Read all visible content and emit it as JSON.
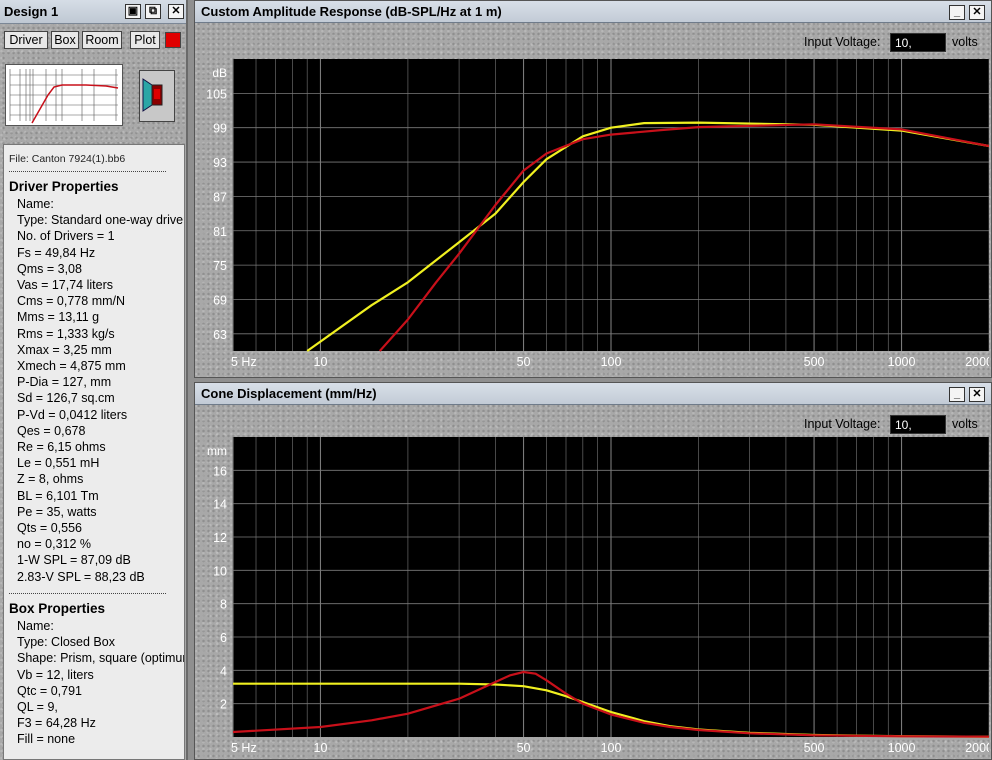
{
  "left_panel": {
    "title": "Design 1",
    "tabs": [
      "Driver",
      "Box",
      "Room",
      "Plot"
    ],
    "file": "File: Canton 7924(1).bb6",
    "driver_heading": "Driver Properties",
    "driver_lines": [
      "Name:",
      "Type: Standard one-way driver",
      "No. of Drivers = 1",
      "Fs = 49,84 Hz",
      "Qms = 3,08",
      "Vas = 17,74 liters",
      "Cms = 0,778 mm/N",
      "Mms = 13,11 g",
      "Rms = 1,333 kg/s",
      "Xmax = 3,25 mm",
      "Xmech = 4,875 mm",
      "P-Dia = 127, mm",
      "Sd = 126,7 sq.cm",
      "P-Vd = 0,0412 liters",
      "Qes = 0,678",
      "Re = 6,15 ohms",
      "Le = 0,551 mH",
      "Z = 8, ohms",
      "BL = 6,101 Tm",
      "Pe = 35, watts",
      "Qts = 0,556",
      "no = 0,312 %",
      "1-W SPL = 87,09 dB",
      "2.83-V SPL = 88,23 dB"
    ],
    "box_heading": "Box Properties",
    "box_lines": [
      "Name:",
      "Type: Closed Box",
      "Shape: Prism, square (optimum)",
      "Vb = 12, liters",
      "Qtc = 0,791",
      "QL = 9,",
      "F3 = 64,28 Hz",
      "Fill = none"
    ]
  },
  "icons": {
    "save": "save-icon",
    "copy": "copy-icon",
    "close": "close-icon",
    "minimize": "minimize-icon"
  },
  "colors": {
    "plot_bg": "#000000",
    "grid": "#7a7a7a",
    "series_red": "#c8101a",
    "series_yellow": "#f0f020",
    "plot_swatch": "#e00000"
  },
  "chart_data": [
    {
      "type": "line",
      "window_title": "Custom Amplitude Response (dB-SPL/Hz at 1 m)",
      "input_voltage_label": "Input Voltage:",
      "input_voltage_value": "10,",
      "input_voltage_unit": "volts",
      "ylabel": "dB",
      "x_scale": "log",
      "xlim": [
        5,
        2000
      ],
      "ylim": [
        60,
        111
      ],
      "yticks": [
        105,
        99,
        93,
        87,
        81,
        75,
        69,
        63
      ],
      "xticks": [
        {
          "v": 5,
          "label": "5 Hz"
        },
        {
          "v": 10,
          "label": "10"
        },
        {
          "v": 50,
          "label": "50"
        },
        {
          "v": 100,
          "label": "100"
        },
        {
          "v": 500,
          "label": "500"
        },
        {
          "v": 1000,
          "label": "1000"
        },
        {
          "v": 2000,
          "label": "2000"
        }
      ],
      "series": [
        {
          "color": "#f0f020",
          "x": [
            9,
            15,
            20,
            30,
            40,
            50,
            60,
            80,
            100,
            130,
            200,
            500,
            1000,
            2000
          ],
          "y": [
            60,
            68,
            72,
            79,
            84,
            89.5,
            93.5,
            97.5,
            99,
            99.8,
            99.9,
            99.5,
            98.5,
            95.8
          ]
        },
        {
          "color": "#c8101a",
          "x": [
            16,
            20,
            25,
            30,
            40,
            50,
            60,
            80,
            100,
            150,
            200,
            500,
            1000,
            2000
          ],
          "y": [
            60,
            65.5,
            72,
            77,
            85.5,
            91.5,
            94.5,
            97,
            97.8,
            98.6,
            99.1,
            99.6,
            98.7,
            95.8
          ]
        }
      ]
    },
    {
      "type": "line",
      "window_title": "Cone Displacement (mm/Hz)",
      "input_voltage_label": "Input Voltage:",
      "input_voltage_value": "10,",
      "input_voltage_unit": "volts",
      "ylabel": "mm",
      "x_scale": "log",
      "xlim": [
        5,
        2000
      ],
      "ylim": [
        0,
        18
      ],
      "yticks": [
        16,
        14,
        12,
        10,
        8,
        6,
        4,
        2
      ],
      "xticks": [
        {
          "v": 5,
          "label": "5 Hz"
        },
        {
          "v": 10,
          "label": "10"
        },
        {
          "v": 50,
          "label": "50"
        },
        {
          "v": 100,
          "label": "100"
        },
        {
          "v": 500,
          "label": "500"
        },
        {
          "v": 1000,
          "label": "1000"
        },
        {
          "v": 2000,
          "label": "2000"
        }
      ],
      "series": [
        {
          "color": "#f0f020",
          "x": [
            5,
            10,
            20,
            30,
            40,
            50,
            60,
            70,
            80,
            100,
            130,
            160,
            200,
            300,
            500,
            1000,
            2000
          ],
          "y": [
            3.2,
            3.2,
            3.2,
            3.2,
            3.15,
            3.05,
            2.8,
            2.45,
            2.1,
            1.5,
            0.95,
            0.65,
            0.45,
            0.25,
            0.12,
            0.05,
            0.02
          ]
        },
        {
          "color": "#c8101a",
          "x": [
            5,
            10,
            15,
            20,
            30,
            40,
            45,
            50,
            55,
            60,
            70,
            80,
            100,
            130,
            160,
            200,
            300,
            500,
            1000,
            2000
          ],
          "y": [
            0.3,
            0.6,
            1.0,
            1.4,
            2.3,
            3.3,
            3.7,
            3.9,
            3.8,
            3.4,
            2.6,
            2.0,
            1.35,
            0.85,
            0.6,
            0.42,
            0.22,
            0.1,
            0.04,
            0.02
          ]
        }
      ]
    }
  ]
}
